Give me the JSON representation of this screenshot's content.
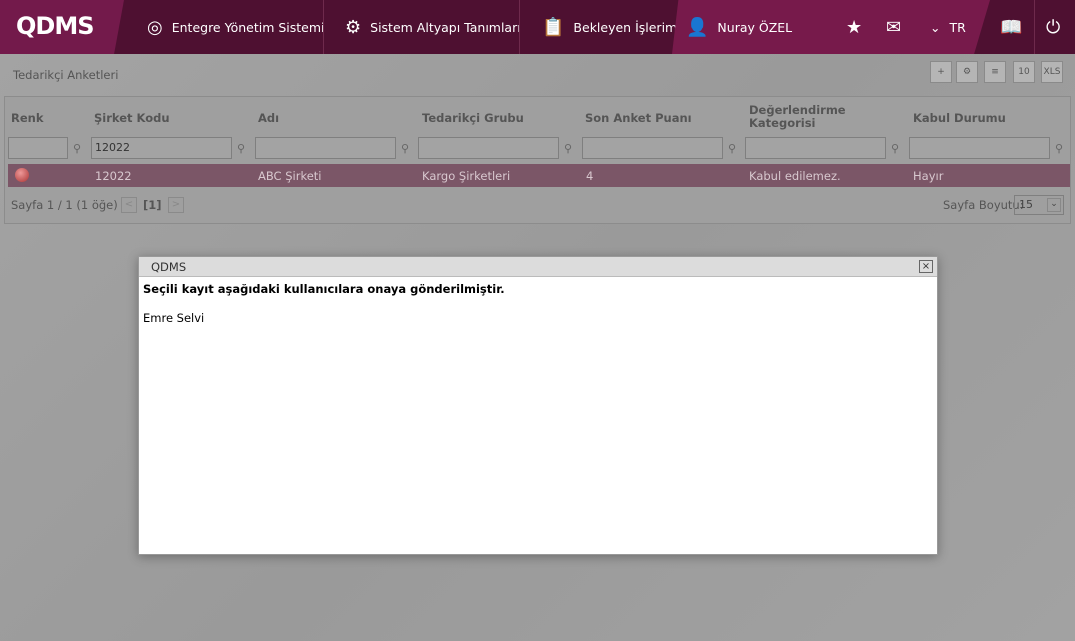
{
  "header": {
    "logo": "QDMS",
    "nav": [
      "Entegre Yönetim Sistemi",
      "Sistem Altyapı Tanımları",
      "Bekleyen İşlerim"
    ],
    "user": "Nuray ÖZEL",
    "lang": "TR"
  },
  "page": {
    "title": "Tedarikçi Anketleri",
    "toolbar_calendar": "10",
    "toolbar_xls": "XLS"
  },
  "grid": {
    "columns": [
      "Renk",
      "Şirket Kodu",
      "Adı",
      "Tedarikçi Grubu",
      "Son Anket Puanı",
      "Değerlendirme Kategorisi",
      "Kabul Durumu"
    ],
    "filters": [
      "",
      "12022",
      "",
      "",
      "",
      "",
      ""
    ],
    "rows": [
      {
        "code": "12022",
        "name": "ABC Şirketi",
        "group": "Kargo Şirketleri",
        "score": "4",
        "category": "Kabul edilemez.",
        "accept": "Hayır"
      }
    ],
    "pager": {
      "info": "Sayfa 1 / 1 (1 öğe)",
      "current": "[1]",
      "size_label": "Sayfa Boyutu:",
      "size": "15"
    }
  },
  "dialog": {
    "title": "QDMS",
    "message": "Seçili kayıt aşağıdaki kullanıcılara onaya gönderilmiştir.",
    "users": "Emre Selvi",
    "close": "×"
  }
}
